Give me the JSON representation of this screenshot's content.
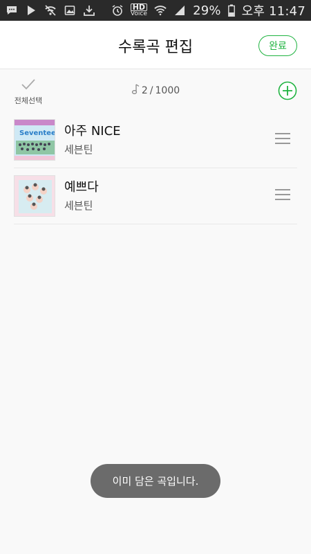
{
  "status_bar": {
    "battery": "29%",
    "time": "오후 11:47",
    "hd_label": "HD",
    "voice_label": "Voice"
  },
  "header": {
    "title": "수록곡 편집",
    "done_label": "완료"
  },
  "toolbar": {
    "select_all_label": "전체선택",
    "count_current": "2",
    "count_separator": "/",
    "count_max": "1000"
  },
  "tracks": [
    {
      "title": "아주 NICE",
      "artist": "세븐틴",
      "art_label": "Seventeen"
    },
    {
      "title": "예쁘다",
      "artist": "세븐틴"
    }
  ],
  "toast": {
    "message": "이미 담은 곡입니다."
  },
  "colors": {
    "accent": "#1fb340",
    "statusbar": "#2a2a2a",
    "toast": "#6b6b6b"
  },
  "icons": [
    "chat-icon",
    "play-icon",
    "wifi-off-icon",
    "image-icon",
    "download-icon",
    "alarm-icon",
    "wifi-icon",
    "signal-icon",
    "battery-icon",
    "checkmark-icon",
    "music-note-icon",
    "add-circle-icon",
    "drag-handle-icon"
  ]
}
